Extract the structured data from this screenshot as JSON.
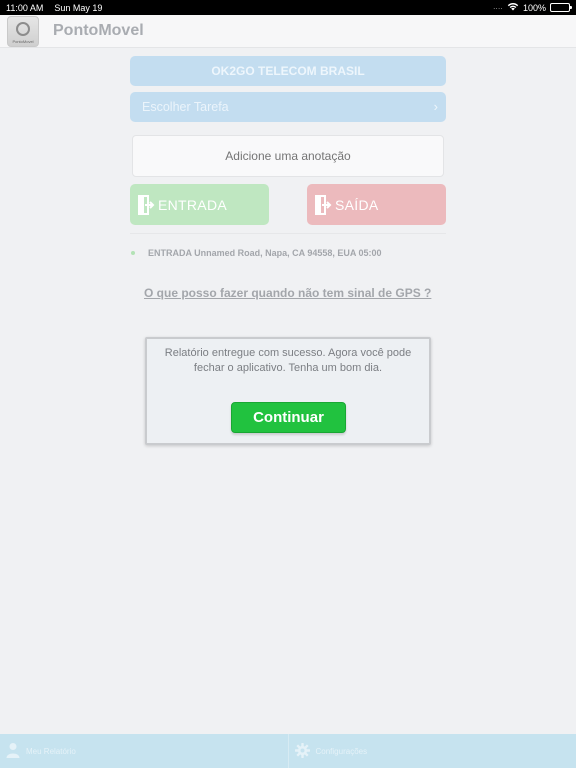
{
  "status_bar": {
    "time": "11:00 AM",
    "date": "Sun May 19",
    "signal": "....",
    "battery": "100%"
  },
  "navbar": {
    "logo_label": "PontoMovel",
    "title": "PontoMovel"
  },
  "company": {
    "name": "OK2GO TELECOM BRASIL"
  },
  "task": {
    "label": "Escolher Tarefa",
    "chevron": "›"
  },
  "note": {
    "placeholder": "Adicione uma anotação",
    "value": ""
  },
  "actions": {
    "entry_label": "ENTRADA",
    "exit_label": "SAÍDA"
  },
  "record": {
    "text": "ENTRADA Unnamed Road, Napa, CA 94558, EUA 05:00"
  },
  "gps_help": {
    "link_text": "O que posso fazer quando não tem sinal de GPS ?"
  },
  "dialog": {
    "message": "Relatório entregue com sucesso. Agora você pode fechar o aplicativo. Tenha um bom dia.",
    "button_label": "Continuar"
  },
  "tabbar": {
    "items": [
      {
        "label": "Meu Relatório",
        "icon": "person-icon"
      },
      {
        "label": "Configurações",
        "icon": "gear-icon"
      }
    ]
  },
  "colors": {
    "entry_button": "#bfe7c1",
    "exit_button": "#ecbabd",
    "banner": "#c3ddf0",
    "continue_button": "#21c23f",
    "tabbar": "#c6e3ef"
  }
}
